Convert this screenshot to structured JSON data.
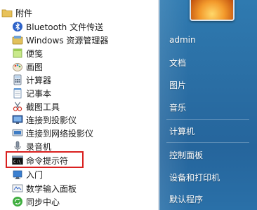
{
  "left_pane": {
    "folder_label": "附件",
    "items": [
      {
        "label": "Bluetooth 文件传送",
        "icon": "bluetooth-icon"
      },
      {
        "label": "Windows 资源管理器",
        "icon": "explorer-icon"
      },
      {
        "label": "便笺",
        "icon": "sticky-notes-icon"
      },
      {
        "label": "画图",
        "icon": "paint-icon"
      },
      {
        "label": "计算器",
        "icon": "calculator-icon"
      },
      {
        "label": "记事本",
        "icon": "notepad-icon"
      },
      {
        "label": "截图工具",
        "icon": "snipping-tool-icon"
      },
      {
        "label": "连接到投影仪",
        "icon": "projector-icon"
      },
      {
        "label": "连接到网络投影仪",
        "icon": "network-projector-icon"
      },
      {
        "label": "录音机",
        "icon": "sound-recorder-icon"
      },
      {
        "label": "命令提示符",
        "icon": "command-prompt-icon"
      },
      {
        "label": "入门",
        "icon": "getting-started-icon"
      },
      {
        "label": "数学输入面板",
        "icon": "math-input-icon"
      },
      {
        "label": "同步中心",
        "icon": "sync-center-icon"
      }
    ]
  },
  "right_pane": {
    "items": [
      "admin",
      "文档",
      "图片",
      "音乐",
      "计算机",
      "控制面板",
      "设备和打印机",
      "默认程序"
    ]
  },
  "colors": {
    "highlight": "#d9201f",
    "right_pane_bg": "#2a6ea4"
  }
}
